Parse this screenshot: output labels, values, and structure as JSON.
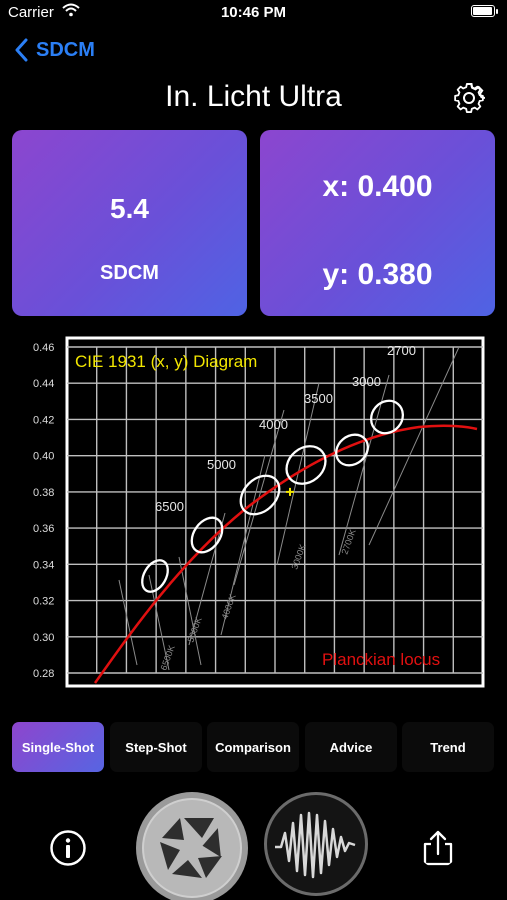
{
  "status": {
    "carrier": "Carrier",
    "time": "10:46 PM",
    "battery_level": 1.0
  },
  "nav": {
    "back_label": "SDCM",
    "title": "In. Licht Ultra"
  },
  "cards": {
    "sdcm_value": "5.4",
    "sdcm_label": "SDCM",
    "x_value": "x: 0.400",
    "y_value": "y: 0.380"
  },
  "chart_data": {
    "type": "scatter",
    "title": "CIE 1931 (x, y) Diagram",
    "yticks": [
      "0.46",
      "0.44",
      "0.42",
      "0.40",
      "0.38",
      "0.36",
      "0.34",
      "0.32",
      "0.30",
      "0.28"
    ],
    "ylim": [
      0.28,
      0.46
    ],
    "grid": true,
    "cct_labels": [
      "6500",
      "5000",
      "4000",
      "3500",
      "3000",
      "2700"
    ],
    "rotated_labels": [
      "6500K",
      "5000K",
      "4000K",
      "3000K",
      "2700K"
    ],
    "curve_label": "Planckian locus",
    "measured_point": {
      "x": 0.4,
      "y": 0.38
    },
    "colors": {
      "curve": "#e11010",
      "measured": "#f2e600",
      "ellipse": "#ffffff",
      "title": "#f2e600"
    }
  },
  "tabs": [
    {
      "label": "Single-Shot",
      "active": true
    },
    {
      "label": "Step-Shot",
      "active": false
    },
    {
      "label": "Comparison",
      "active": false
    },
    {
      "label": "Advice",
      "active": false
    },
    {
      "label": "Trend",
      "active": false
    }
  ],
  "icons": {
    "back": "chevron-left-icon",
    "settings": "gear-icon",
    "info": "info-icon",
    "shutter": "aperture-icon",
    "waveform": "waveform-icon",
    "share": "share-icon"
  }
}
